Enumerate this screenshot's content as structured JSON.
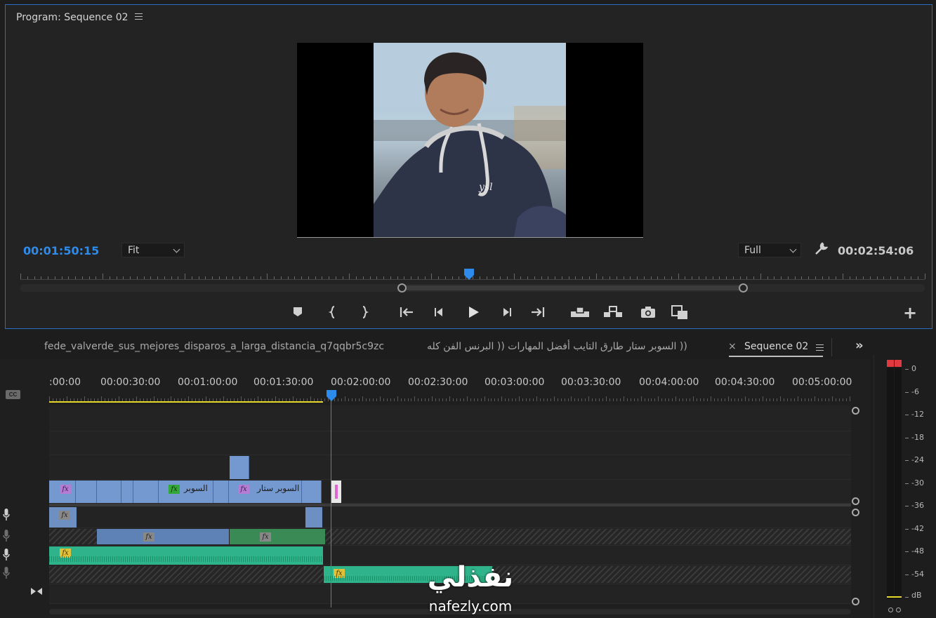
{
  "program_monitor": {
    "title": "Program: Sequence 02",
    "playhead_timecode": "00:01:50:15",
    "fit_label": "Fit",
    "resolution_label": "Full",
    "duration_timecode": "00:02:54:06",
    "playhead_progress": 0.496
  },
  "transport": {
    "add_marker": "add-marker-icon",
    "mark_in": "mark-in-icon",
    "mark_out": "mark-out-icon",
    "go_to_in": "go-to-in-icon",
    "step_back": "step-back-icon",
    "play": "play-icon",
    "step_forward": "step-forward-icon",
    "go_to_out": "go-to-out-icon",
    "lift": "lift-icon",
    "extract": "extract-icon",
    "export_frame": "camera-icon",
    "comparison_view": "comparison-view-icon",
    "add_button": "+"
  },
  "timeline_tabs": {
    "tab1": "fede_valverde_sus_mejores_disparos_a_larga_distancia_q7qqbr5c9zc",
    "tab2": "(( السوبر ستار طارق التايب أفضل المهارات (( البرنس الفن كله",
    "active_tab": "Sequence 02",
    "close": "×",
    "overflow": "»"
  },
  "ruler": {
    "ticks": [
      ":00:00",
      "00:00:30:00",
      "00:01:00:00",
      "00:01:30:00",
      "00:02:00:00",
      "00:02:30:00",
      "00:03:00:00",
      "00:03:30:00",
      "00:04:00:00",
      "00:04:30:00",
      "00:05:00:00"
    ]
  },
  "clips": {
    "v1_label_a": "السوبر",
    "v1_label_b": "السوبر ستار",
    "fx": "fx"
  },
  "audio_meter": {
    "labels": [
      "0",
      "-6",
      "-12",
      "-18",
      "-24",
      "-30",
      "-36",
      "-42",
      "-48",
      "-54",
      "dB"
    ],
    "clip_indicator_color": "#e0393f"
  },
  "watermark": {
    "arabic": "نفذلي",
    "latin": "nafezly.com"
  },
  "colors": {
    "accent_blue": "#2d8ceb",
    "video_clip": "#7399d0",
    "audio_clip": "#2fb38a",
    "work_area": "#e6d92a"
  }
}
